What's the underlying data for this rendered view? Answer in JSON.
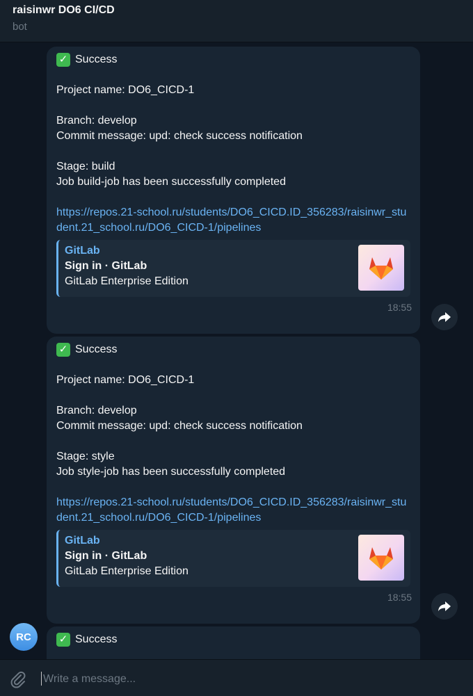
{
  "header": {
    "title": "raisinwr DO6 CI/CD",
    "subtitle": "bot"
  },
  "messages": [
    {
      "status": "Success",
      "project": "Project name: DO6_CICD-1",
      "branch": "Branch: develop",
      "commit": "Commit message: upd: check success notification",
      "stage": "Stage: build",
      "job": "Job build-job has been successfully completed",
      "link": "https://repos.21-school.ru/students/DO6_CICD.ID_356283/raisinwr_student.21_school.ru/DO6_CICD-1/pipelines",
      "preview": {
        "site": "GitLab",
        "title": "Sign in · GitLab",
        "description": "GitLab Enterprise Edition"
      },
      "time": "18:55"
    },
    {
      "status": "Success",
      "project": "Project name: DO6_CICD-1",
      "branch": "Branch: develop",
      "commit": "Commit message: upd: check success notification",
      "stage": "Stage: style",
      "job": "Job style-job has been successfully completed",
      "link": "https://repos.21-school.ru/students/DO6_CICD.ID_356283/raisinwr_student.21_school.ru/DO6_CICD-1/pipelines",
      "preview": {
        "site": "GitLab",
        "title": "Sign in · GitLab",
        "description": "GitLab Enterprise Edition"
      },
      "time": "18:55"
    },
    {
      "status": "Success"
    }
  ],
  "avatar": {
    "initials": "RC"
  },
  "composer": {
    "placeholder": "Write a message..."
  },
  "icons": {
    "status": "check-mark-icon",
    "share": "share-arrow-icon",
    "attach": "paperclip-icon",
    "preview": "gitlab-logo-icon"
  },
  "colors": {
    "background": "#0e1621",
    "bubble": "#182533",
    "link": "#6ab3f3",
    "success": "#3fb950"
  }
}
